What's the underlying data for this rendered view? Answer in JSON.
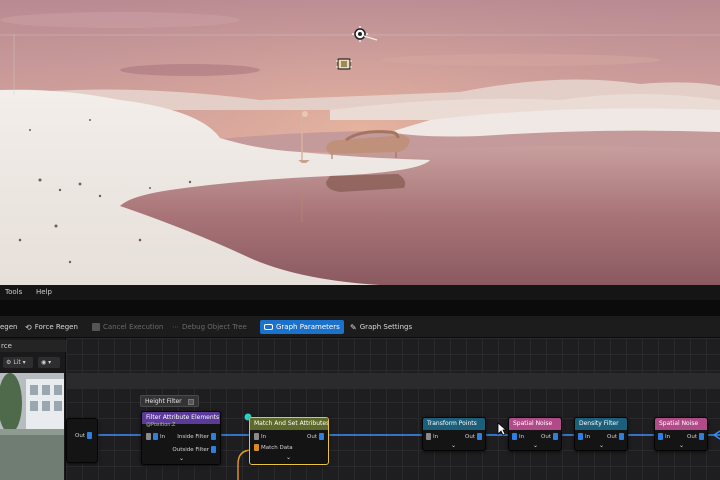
{
  "menu": {
    "items": [
      "Tools",
      "Help"
    ]
  },
  "toolbar": {
    "regen_partial": "egen",
    "force_regen": "Force Regen",
    "cancel_execution": "Cancel Execution",
    "debug_object_tree": "Debug Object Tree",
    "graph_parameters": "Graph Parameters",
    "graph_settings": "Graph Settings"
  },
  "preview_panel": {
    "title": "rce",
    "lit_mode": "Lit",
    "view_toggle": ""
  },
  "graph": {
    "comment": "Height Filter",
    "nodes": {
      "out_left": {
        "out": "Out"
      },
      "filter_attr": {
        "title": "Filter Attribute Elements",
        "subtitle": "@Position.Z",
        "in": "In",
        "inside": "Inside Filter",
        "outside": "Outside Filter"
      },
      "match_set": {
        "title": "Match And Set Attributes",
        "in": "In",
        "out": "Out",
        "match": "Match Data"
      },
      "transform": {
        "title": "Transform Points",
        "in": "In",
        "out": "Out"
      },
      "noise1": {
        "title": "Spatial Noise",
        "in": "In",
        "out": "Out"
      },
      "density": {
        "title": "Density Filter",
        "in": "In",
        "out": "Out"
      },
      "noise2": {
        "title": "Spatial Noise",
        "in": "In",
        "out": "Out"
      }
    }
  },
  "colors": {
    "accent": "#1a72cc",
    "pin_blue": "#2f7fe0",
    "wire_blue": "#3b8ef5",
    "wire_orange": "#e69a26",
    "selected_outline": "#e8c33b",
    "header_purple": "#5b3a9a",
    "header_teal": "#1c5f7a",
    "header_pink": "#b04a88",
    "header_olive": "#5d6a2c"
  },
  "icons": [
    "sun-light-icon",
    "reflection-capture-icon",
    "gear-icon",
    "eye-icon",
    "mouse-cursor-icon"
  ]
}
